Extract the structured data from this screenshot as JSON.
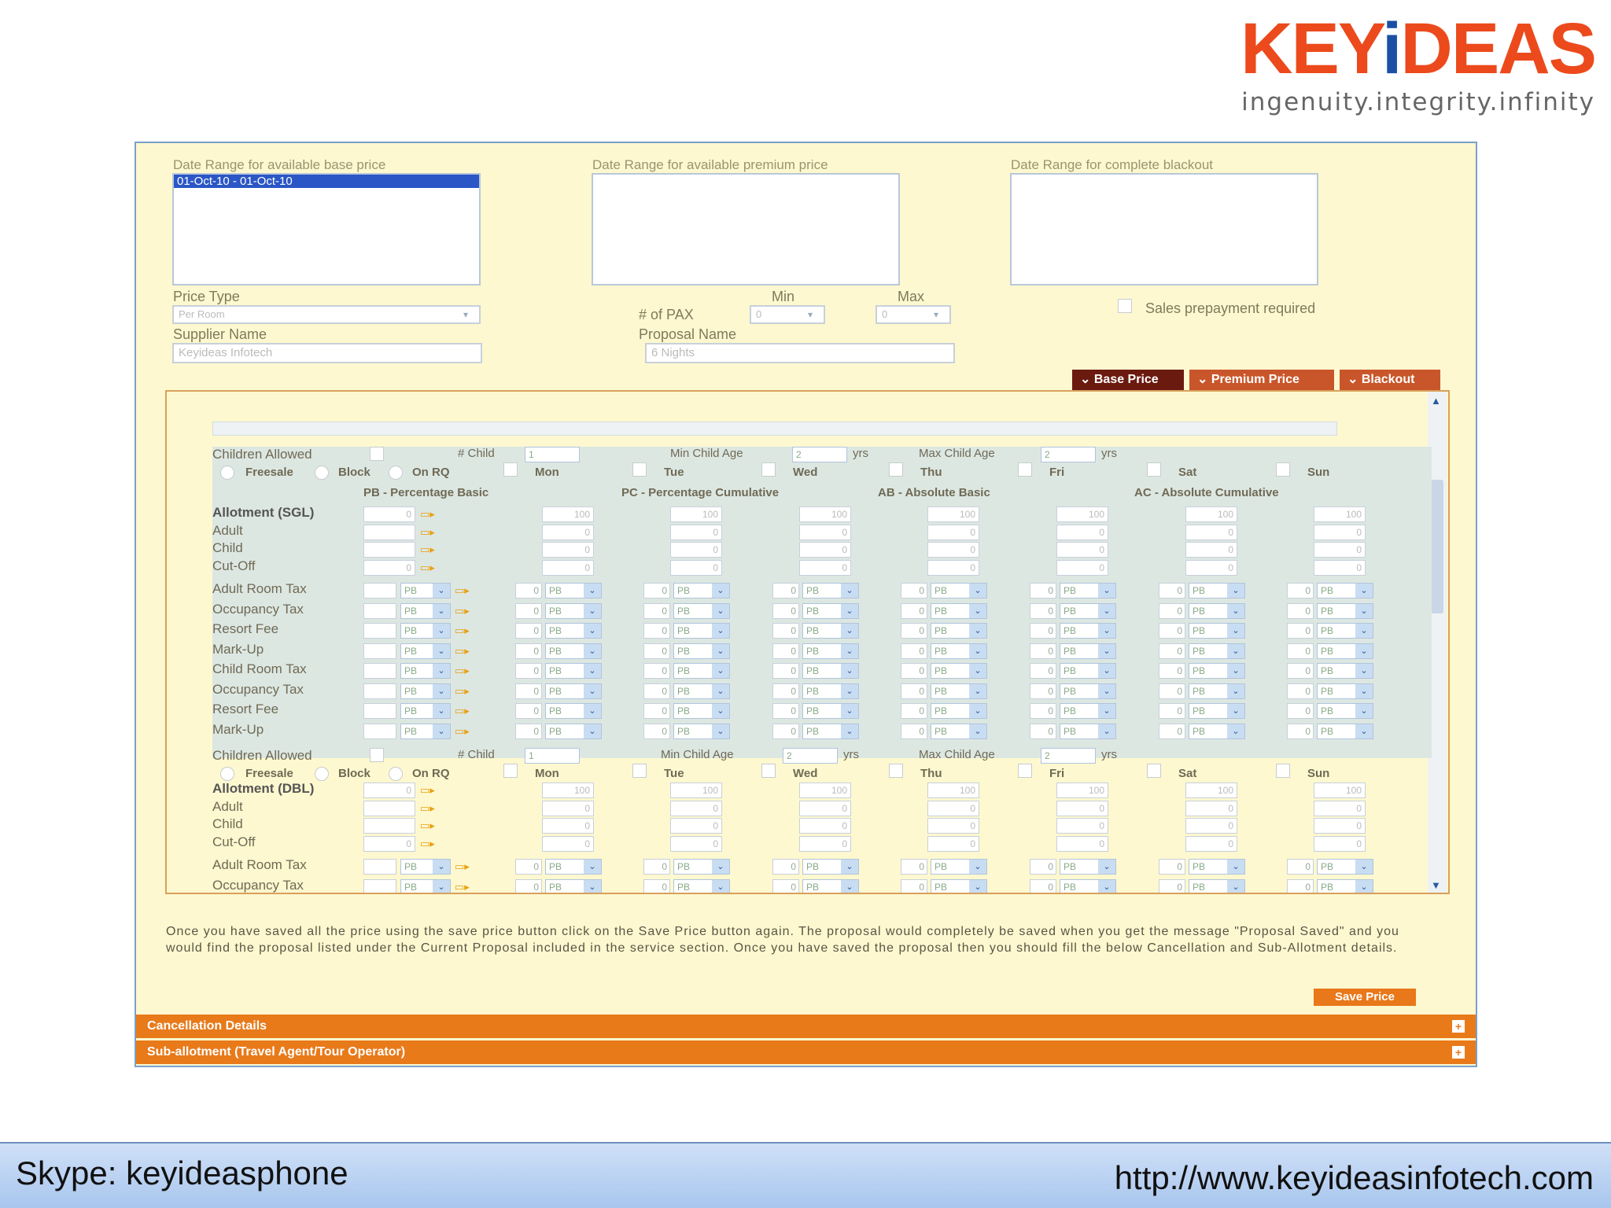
{
  "logo": {
    "brand_pre": "KEY",
    "brand_i": "i",
    "brand_post": "DEAS",
    "tagline": "ingenuity.integrity.infinity"
  },
  "form": {
    "base_label": "Date Range for available base price",
    "base_item": "01-Oct-10  -  01-Oct-10",
    "premium_label": "Date Range for available premium price",
    "blackout_label": "Date Range for complete blackout",
    "price_type_label": "Price Type",
    "price_type_value": "Per Room",
    "pax_label": "# of PAX",
    "min_label": "Min",
    "max_label": "Max",
    "min_value": "0",
    "max_value": "0",
    "sales_prepay": "Sales prepayment required",
    "supplier_label": "Supplier Name",
    "supplier_value": "Keyideas Infotech",
    "proposal_label": "Proposal Name",
    "proposal_value": "6 Nights"
  },
  "tabs": {
    "base": "Base Price",
    "premium": "Premium Price",
    "blackout": "Blackout"
  },
  "grid": {
    "children_allowed": "Children Allowed",
    "num_child": "# Child",
    "num_child_val": "1",
    "min_child_age": "Min Child Age",
    "max_child_age": "Max Child Age",
    "age_val": "2",
    "yrs": "yrs",
    "freesale": "Freesale",
    "block": "Block",
    "onrq": "On RQ",
    "days": [
      "Mon",
      "Tue",
      "Wed",
      "Thu",
      "Fri",
      "Sat",
      "Sun"
    ],
    "pb": "PB - Percentage Basic",
    "pc": "PC - Percentage Cumulative",
    "ab": "AB - Absolute Basic",
    "ac": "AC - Absolute Cumulative",
    "allot_sgl": "Allotment (SGL)",
    "allot_dbl": "Allotment (DBL)",
    "adult": "Adult",
    "child": "Child",
    "cutoff": "Cut-Off",
    "tax_rows": [
      "Adult Room Tax",
      "Occupancy Tax",
      "Resort Fee",
      "Mark-Up",
      "Child Room Tax",
      "Occupancy Tax",
      "Resort Fee",
      "Mark-Up"
    ],
    "tax_rows2": [
      "Adult Room Tax",
      "Occupancy Tax"
    ],
    "val100": "100",
    "val0": "0",
    "pb_opt": "PB"
  },
  "note": "Once you have saved all the price using the save price button click on the Save Price button again. The proposal would completely be saved when you get the message \"Proposal Saved\" and you would find the proposal listed under the Current Proposal included in the service section. Once you have saved the proposal then you should fill the below Cancellation and Sub-Allotment details.",
  "save_price": "Save Price",
  "bars": {
    "cancellation": "Cancellation Details",
    "suballot": "Sub-allotment (Travel Agent/Tour Operator)"
  },
  "footer": {
    "skype": "Skype: keyideasphone",
    "url": "http://www.keyideasinfotech.com"
  },
  "colors": {
    "accent": "#ec4a1c",
    "logo_i": "#1b4fa5",
    "panel": "#fdf8cf",
    "bar": "#e87a1a",
    "tab_active": "#6b1a10",
    "tab": "#c9562a"
  }
}
